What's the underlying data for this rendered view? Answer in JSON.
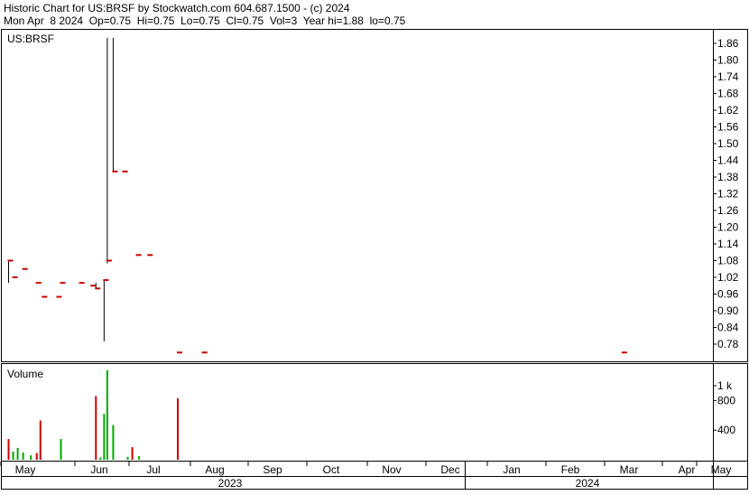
{
  "header": {
    "line1": "Historic Chart for US:BRSF by Stockwatch.com 604.687.1500 - (c) 2024",
    "line2": "Mon Apr  8 2024  Op=0.75  Hi=0.75  Lo=0.75  Cl=0.75  Vol=3  Year hi=1.88  lo=0.75"
  },
  "colors": {
    "up": "#00aa00",
    "down": "#cc0000",
    "flat": "#000000",
    "grid": "#000000"
  },
  "chart_data": [
    {
      "type": "ohlc",
      "title": "US:BRSF",
      "y_ticks": [
        "1.86",
        "1.80",
        "1.74",
        "1.68",
        "1.62",
        "1.56",
        "1.50",
        "1.44",
        "1.38",
        "1.32",
        "1.26",
        "1.20",
        "1.14",
        "1.08",
        "1.02",
        "0.96",
        "0.90",
        "0.84",
        "0.78"
      ],
      "ylim": [
        0.73,
        1.88
      ],
      "x_months": [
        "May",
        "Jun",
        "Jul",
        "Aug",
        "Sep",
        "Oct",
        "Nov",
        "Dec",
        "Jan",
        "Feb",
        "Mar",
        "Apr",
        "May"
      ],
      "x_years": [
        "2023",
        "2024"
      ],
      "bars": [
        {
          "x": 0.3,
          "hi": 1.08,
          "lo": 1.0,
          "close": 1.08
        },
        {
          "x": 1.3,
          "hi": 1.02,
          "lo": 1.02,
          "close": 1.02
        },
        {
          "x": 3.5,
          "hi": 1.05,
          "lo": 1.05,
          "close": 1.05
        },
        {
          "x": 6.5,
          "hi": 1.0,
          "lo": 1.0,
          "close": 1.0
        },
        {
          "x": 7.8,
          "hi": 0.95,
          "lo": 0.95,
          "close": 0.95
        },
        {
          "x": 11.0,
          "hi": 0.95,
          "lo": 0.95,
          "close": 0.95
        },
        {
          "x": 11.8,
          "hi": 1.0,
          "lo": 1.0,
          "close": 1.0
        },
        {
          "x": 16.0,
          "hi": 1.0,
          "lo": 1.0,
          "close": 1.0
        },
        {
          "x": 18.5,
          "hi": 0.99,
          "lo": 0.99,
          "close": 0.99
        },
        {
          "x": 19.5,
          "hi": 1.0,
          "lo": 0.98,
          "close": 0.98
        },
        {
          "x": 21.3,
          "hi": 1.01,
          "lo": 0.79,
          "close": 1.01
        },
        {
          "x": 22.0,
          "hi": 1.88,
          "lo": 1.07,
          "close": 1.08
        },
        {
          "x": 23.3,
          "hi": 1.88,
          "lo": 1.4,
          "close": 1.4
        },
        {
          "x": 25.5,
          "hi": 1.4,
          "lo": 1.4,
          "close": 1.4
        },
        {
          "x": 28.5,
          "hi": 1.1,
          "lo": 1.1,
          "close": 1.1
        },
        {
          "x": 31.0,
          "hi": 1.1,
          "lo": 1.1,
          "close": 1.1
        },
        {
          "x": 37.5,
          "hi": 0.75,
          "lo": 0.75,
          "close": 0.75
        },
        {
          "x": 43.0,
          "hi": 0.75,
          "lo": 0.75,
          "close": 0.75
        },
        {
          "x": 135.3,
          "hi": 0.75,
          "lo": 0.75,
          "close": 0.75
        }
      ]
    },
    {
      "type": "bar",
      "title": "Volume",
      "y_ticks": [
        {
          "v": 1000,
          "label": "1 k"
        },
        {
          "v": 800,
          "label": "800"
        },
        {
          "v": 400,
          "label": "400"
        }
      ],
      "ylim": [
        0,
        1200
      ],
      "bars": [
        {
          "x": 0.3,
          "v": 280,
          "dir": "down"
        },
        {
          "x": 1.3,
          "v": 110,
          "dir": "up"
        },
        {
          "x": 2.3,
          "v": 160,
          "dir": "up"
        },
        {
          "x": 3.5,
          "v": 100,
          "dir": "up"
        },
        {
          "x": 5.2,
          "v": 60,
          "dir": "up"
        },
        {
          "x": 6.5,
          "v": 90,
          "dir": "down"
        },
        {
          "x": 7.3,
          "v": 530,
          "dir": "down"
        },
        {
          "x": 11.8,
          "v": 280,
          "dir": "up"
        },
        {
          "x": 19.5,
          "v": 860,
          "dir": "down"
        },
        {
          "x": 20.5,
          "v": 30,
          "dir": "up"
        },
        {
          "x": 21.3,
          "v": 620,
          "dir": "up"
        },
        {
          "x": 22.0,
          "v": 1210,
          "dir": "up"
        },
        {
          "x": 23.3,
          "v": 470,
          "dir": "up"
        },
        {
          "x": 26.5,
          "v": 40,
          "dir": "up"
        },
        {
          "x": 27.5,
          "v": 170,
          "dir": "down"
        },
        {
          "x": 29.0,
          "v": 50,
          "dir": "up"
        },
        {
          "x": 37.5,
          "v": 830,
          "dir": "down"
        }
      ]
    }
  ]
}
